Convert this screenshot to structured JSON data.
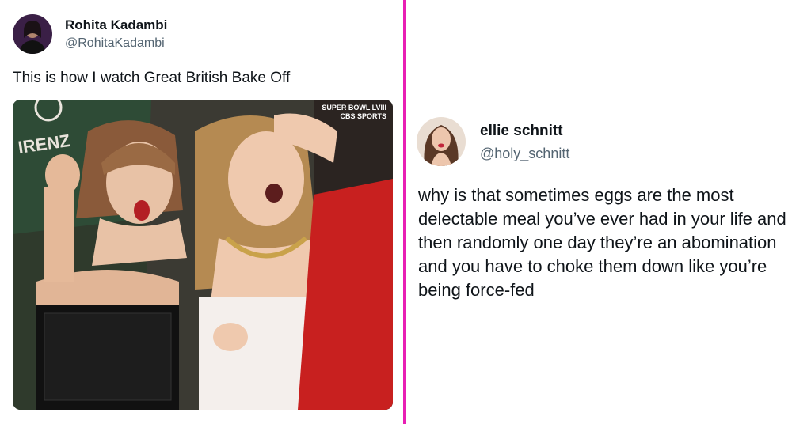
{
  "left_tweet": {
    "display_name": "Rohita Kadambi",
    "handle": "@RohitaKadambi",
    "text": "This is how I watch Great British Bake Off",
    "media": {
      "broadcast_logo_line1": "SUPER BOWL LVIII",
      "broadcast_logo_line2": "CBS SPORTS",
      "jersey_text": "IRENZ"
    }
  },
  "right_tweet": {
    "display_name": "ellie schnitt",
    "handle": "@holy_schnitt",
    "text": "why is that sometimes eggs are the most delectable meal you’ve ever had in your life and then randomly one day they’re an abomination and you have to choke them down like you’re being force-fed"
  },
  "colors": {
    "divider": "#e81fb4",
    "name": "#0f1419",
    "handle": "#536471"
  }
}
